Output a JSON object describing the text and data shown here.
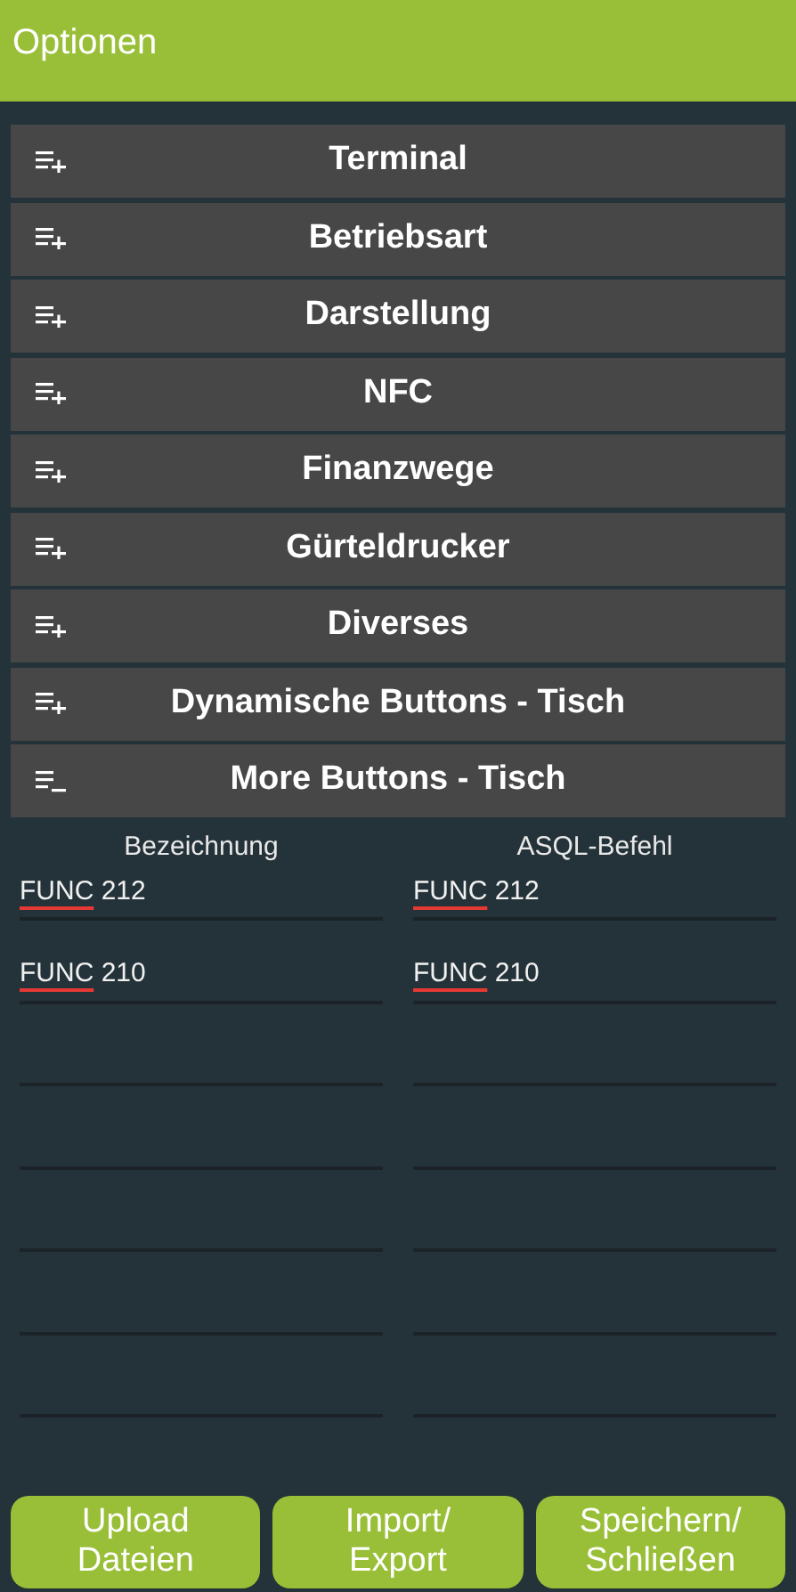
{
  "app_bar": {
    "title": "Optionen"
  },
  "sections": [
    {
      "label": "Terminal",
      "expanded": false
    },
    {
      "label": "Betriebsart",
      "expanded": false
    },
    {
      "label": "Darstellung",
      "expanded": false
    },
    {
      "label": "NFC",
      "expanded": false
    },
    {
      "label": "Finanzwege",
      "expanded": false
    },
    {
      "label": "Gürteldrucker",
      "expanded": false
    },
    {
      "label": "Diverses",
      "expanded": false
    },
    {
      "label": "Dynamische Buttons - Tisch",
      "expanded": false
    },
    {
      "label": "More Buttons - Tisch",
      "expanded": true
    }
  ],
  "table": {
    "columns": [
      "Bezeichnung",
      "ASQL-Befehl"
    ],
    "rows": [
      {
        "name": {
          "value": "FUNC 212",
          "spellcheck": true
        },
        "command": {
          "value": "FUNC 212",
          "spellcheck": true
        }
      },
      {
        "name": {
          "value": "FUNC 210",
          "spellcheck": true
        },
        "command": {
          "value": "FUNC 210",
          "spellcheck": true
        }
      },
      {
        "name": {},
        "command": {}
      },
      {
        "name": {},
        "command": {}
      },
      {
        "name": {},
        "command": {}
      },
      {
        "name": {},
        "command": {}
      },
      {
        "name": {},
        "command": {}
      }
    ]
  },
  "buttons": [
    "Upload Dateien",
    "Import/ Export",
    "Speichern/ Schließen"
  ]
}
